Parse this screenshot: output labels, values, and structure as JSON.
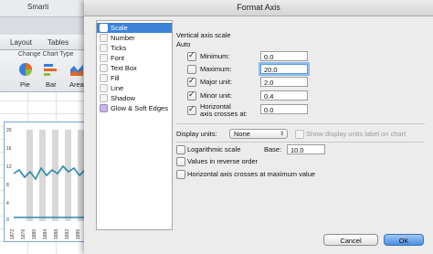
{
  "background": {
    "menubar": [
      "Smarti"
    ],
    "ribbon_tabs": [
      "Layout",
      "Tables"
    ],
    "ribbon_group": "Change Chart Type",
    "chart_types": [
      "Pie",
      "Bar",
      "Area"
    ],
    "chart_y_ticks": [
      "20",
      "18",
      "16",
      "14",
      "12",
      "10",
      "8",
      "6",
      "4",
      "2",
      "0"
    ],
    "chart_x_ticks": [
      "1872",
      "1876",
      "1880",
      "1884",
      "1888",
      "1892",
      "1896",
      "1900"
    ]
  },
  "dialog": {
    "title": "Format Axis",
    "nav": [
      {
        "label": "Scale",
        "icon": "scale-icon",
        "selected": true
      },
      {
        "label": "Number",
        "icon": "number-icon"
      },
      {
        "label": "Ticks",
        "icon": "ticks-icon"
      },
      {
        "label": "Font",
        "icon": "font-icon"
      },
      {
        "label": "Text Box",
        "icon": "text-box-icon"
      },
      {
        "label": "Fill",
        "icon": "fill-icon"
      },
      {
        "label": "Line",
        "icon": "line-icon"
      },
      {
        "label": "Shadow",
        "icon": "shadow-icon"
      },
      {
        "label": "Glow & Soft Edges",
        "icon": "glow-icon"
      }
    ],
    "scale": {
      "heading": "Vertical axis scale",
      "auto_label": "Auto",
      "rows": [
        {
          "label": "Minimum:",
          "checked": true,
          "value": "0.0"
        },
        {
          "label": "Maximum:",
          "checked": false,
          "value": "20.0"
        },
        {
          "label": "Major unit:",
          "checked": true,
          "value": "2.0"
        },
        {
          "label": "Minor unit:",
          "checked": true,
          "value": "0.4"
        },
        {
          "label": "Horizontal",
          "label2": "axis crosses at:",
          "checked": true,
          "value": "0.0"
        }
      ],
      "display_units_label": "Display units:",
      "display_units_value": "None",
      "show_units_label": "Show display units label on chart",
      "log_scale_label": "Logarithmic scale",
      "base_label": "Base:",
      "base_value": "10.0",
      "reverse_label": "Values in reverse order",
      "cross_max_label": "Horizontal axis crosses at maximum value"
    },
    "buttons": {
      "cancel": "Cancel",
      "ok": "OK"
    }
  }
}
